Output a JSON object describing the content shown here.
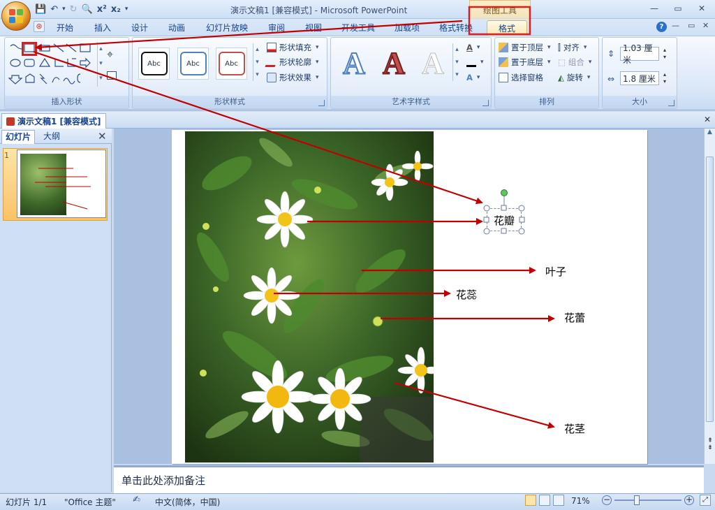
{
  "window": {
    "title": "演示文稿1 [兼容模式] - Microsoft PowerPoint",
    "contextual_tools": "绘图工具",
    "minimize": "—",
    "restore": "▭",
    "close": "✕"
  },
  "ribbon_tabs": [
    {
      "label": "开始"
    },
    {
      "label": "插入"
    },
    {
      "label": "设计"
    },
    {
      "label": "动画"
    },
    {
      "label": "幻灯片放映"
    },
    {
      "label": "审阅"
    },
    {
      "label": "视图"
    },
    {
      "label": "开发工具"
    },
    {
      "label": "加载项"
    },
    {
      "label": "格式转换"
    },
    {
      "label": "格式"
    }
  ],
  "groups": {
    "insert_shapes": {
      "label": "插入形状"
    },
    "shape_styles": {
      "label": "形状样式",
      "samples": [
        "Abc",
        "Abc",
        "Abc"
      ],
      "fill": "形状填充",
      "outline": "形状轮廓",
      "effects": "形状效果"
    },
    "wordart": {
      "label": "艺术字样式",
      "samples": [
        "A",
        "A",
        "A"
      ]
    },
    "arrange": {
      "label": "排列",
      "bring_front": "置于顶层",
      "send_back": "置于底层",
      "selection_pane": "选择窗格",
      "align": "对齐",
      "group": "组合",
      "rotate": "旋转"
    },
    "size": {
      "label": "大小",
      "height": "1.03 厘米",
      "width": "1.8 厘米"
    }
  },
  "document_tab": "演示文稿1 [兼容模式]",
  "left_pane": {
    "tab_slides": "幻灯片",
    "tab_outline": "大纲",
    "slide_number": "1"
  },
  "slide": {
    "labels": {
      "petal": "花瓣",
      "leaf": "叶子",
      "pistil": "花蕊",
      "bud": "花蕾",
      "stem": "花茎"
    }
  },
  "notes_placeholder": "单击此处添加备注",
  "status": {
    "slide": "幻灯片 1/1",
    "theme": "\"Office 主题\"",
    "language": "中文(简体，中国)",
    "zoom": "71%"
  },
  "colors": {
    "annotation_arrow": "#c00000",
    "ribbon_bg": "#dbe8f8"
  }
}
